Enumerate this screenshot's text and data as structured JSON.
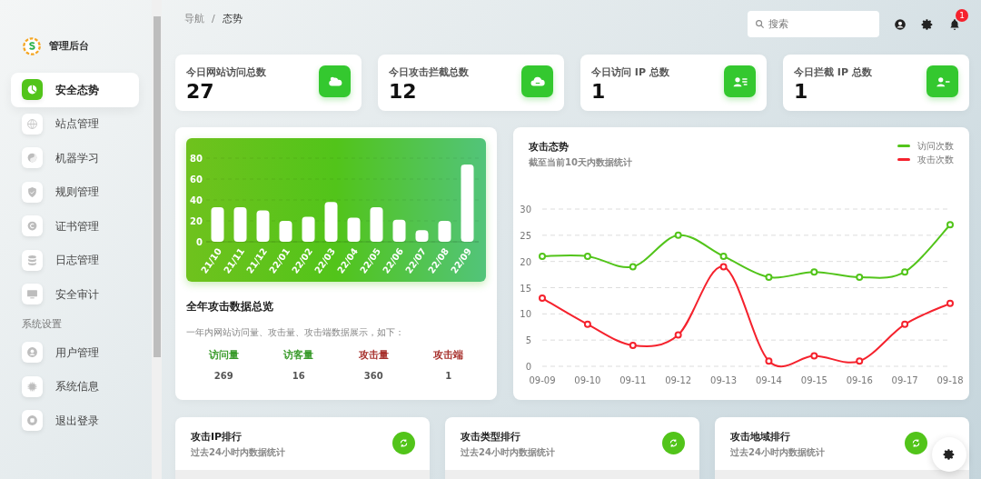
{
  "brand": {
    "title": "管理后台"
  },
  "sidebar": {
    "items": [
      {
        "label": "安全态势",
        "selected": true
      },
      {
        "label": "站点管理",
        "selected": false
      },
      {
        "label": "机器学习",
        "selected": false
      },
      {
        "label": "规则管理",
        "selected": false
      },
      {
        "label": "证书管理",
        "selected": false
      },
      {
        "label": "日志管理",
        "selected": false
      },
      {
        "label": "安全审计",
        "selected": false
      }
    ],
    "section_label": "系统设置",
    "settings_items": [
      {
        "label": "用户管理",
        "selected": false
      },
      {
        "label": "系统信息",
        "selected": false
      },
      {
        "label": "退出登录",
        "selected": false
      }
    ]
  },
  "breadcrumb": {
    "items": [
      "导航",
      "态势"
    ],
    "separator": "/"
  },
  "search": {
    "placeholder": "搜索"
  },
  "notifications": {
    "count": "1"
  },
  "stats": [
    {
      "label": "今日网站访问总数",
      "value": "27"
    },
    {
      "label": "今日攻击拦截总数",
      "value": "12"
    },
    {
      "label": "今日访问 IP 总数",
      "value": "1"
    },
    {
      "label": "今日拦截 IP 总数",
      "value": "1"
    }
  ],
  "year_card": {
    "chart_data": {
      "type": "bar",
      "categories": [
        "21/10",
        "21/11",
        "21/12",
        "22/01",
        "22/02",
        "22/03",
        "22/04",
        "22/05",
        "22/06",
        "22/07",
        "22/08",
        "22/09"
      ],
      "values": [
        33,
        33,
        30,
        20,
        24,
        38,
        23,
        33,
        21,
        11,
        20,
        74
      ],
      "ylim": [
        0,
        80
      ],
      "yticks": [
        0,
        20,
        40,
        60,
        80
      ],
      "grid": true
    },
    "title": "全年攻击数据总览",
    "description": "一年内网站访问量、攻击量、攻击端数据展示，如下：",
    "metrics": [
      {
        "label": "访问量",
        "value": "269",
        "color": "#3a9b2c"
      },
      {
        "label": "访客量",
        "value": "16",
        "color": "#3a9b2c"
      },
      {
        "label": "攻击量",
        "value": "360",
        "color": "#a8322e"
      },
      {
        "label": "攻击端",
        "value": "1",
        "color": "#a8322e"
      }
    ]
  },
  "trend_card": {
    "title": "攻击态势",
    "subtitle": "截至当前10天内数据统计",
    "chart_data": {
      "type": "line",
      "categories": [
        "09-09",
        "09-10",
        "09-11",
        "09-12",
        "09-13",
        "09-14",
        "09-15",
        "09-16",
        "09-17",
        "09-18"
      ],
      "ylim": [
        0,
        30
      ],
      "yticks": [
        0,
        5,
        10,
        15,
        20,
        25,
        30
      ],
      "grid": true,
      "series": [
        {
          "name": "访问次数",
          "color": "#52c41a",
          "marker": true,
          "values": [
            21,
            21,
            19,
            25,
            21,
            17,
            18,
            17,
            18,
            27
          ]
        },
        {
          "name": "攻击次数",
          "color": "#f5222d",
          "marker": true,
          "values": [
            13,
            8,
            4,
            6,
            19,
            1,
            2,
            1,
            8,
            12
          ]
        }
      ]
    }
  },
  "rank_cards": [
    {
      "title": "攻击IP排行",
      "subtitle": "过去24小时内数据统计"
    },
    {
      "title": "攻击类型排行",
      "subtitle": "过去24小时内数据统计"
    },
    {
      "title": "攻击地域排行",
      "subtitle": "过去24小时内数据统计"
    }
  ]
}
